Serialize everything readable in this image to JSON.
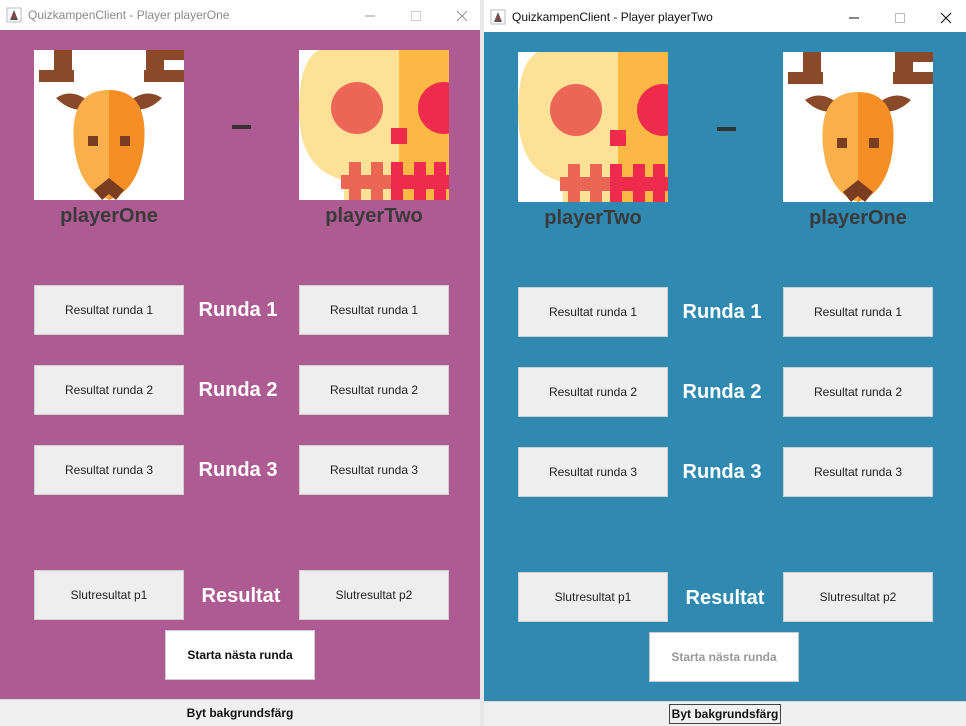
{
  "colors": {
    "window1_bg": "#ad5b92",
    "window2_bg": "#2f89b1"
  },
  "icons": {
    "deer": "deer-avatar-icon",
    "skull": "skull-avatar-icon"
  },
  "window1": {
    "title": "QuizkampenClient - Player playerOne",
    "left_player": "playerOne",
    "right_player": "playerTwo",
    "left_avatar": "deer",
    "right_avatar": "skull",
    "rounds": [
      {
        "left": "Resultat runda 1",
        "label": "Runda 1",
        "right": "Resultat runda 1"
      },
      {
        "left": "Resultat runda 2",
        "label": "Runda 2",
        "right": "Resultat runda 2"
      },
      {
        "left": "Resultat runda 3",
        "label": "Runda 3",
        "right": "Resultat runda 3"
      }
    ],
    "final": {
      "left": "Slutresultat p1",
      "label": "Resultat",
      "right": "Slutresultat p2"
    },
    "start_button": "Starta nästa runda",
    "start_enabled": true,
    "bottom_button": "Byt bakgrundsfärg"
  },
  "window2": {
    "title": "QuizkampenClient - Player playerTwo",
    "left_player": "playerTwo",
    "right_player": "playerOne",
    "left_avatar": "skull",
    "right_avatar": "deer",
    "rounds": [
      {
        "left": "Resultat runda 1",
        "label": "Runda 1",
        "right": "Resultat runda 1"
      },
      {
        "left": "Resultat runda 2",
        "label": "Runda 2",
        "right": "Resultat runda 2"
      },
      {
        "left": "Resultat runda 3",
        "label": "Runda 3",
        "right": "Resultat runda 3"
      }
    ],
    "final": {
      "left": "Slutresultat p1",
      "label": "Resultat",
      "right": "Slutresultat p2"
    },
    "start_button": "Starta nästa runda",
    "start_enabled": false,
    "bottom_button": "Byt bakgrundsfärg"
  }
}
